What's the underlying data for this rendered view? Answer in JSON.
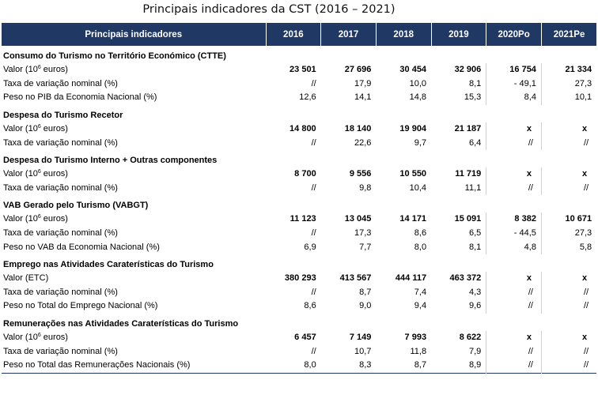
{
  "title": "Principais indicadores da CST (2016 – 2021)",
  "header": {
    "label": "Principais indicadores",
    "years": [
      "2016",
      "2017",
      "2018",
      "2019",
      "2020Po",
      "2021Pe"
    ]
  },
  "sections": [
    {
      "heading": "Consumo do Turismo no Território Económico (CTTE)",
      "rows": [
        {
          "label_pre": "Valor (10",
          "sup": "6",
          "label_post": " euros)",
          "type": "val",
          "values": [
            "23 501",
            "27 696",
            "30 454",
            "32 906",
            "16 754",
            "21 334"
          ]
        },
        {
          "label": "Taxa de variação nominal (%)",
          "values": [
            "//",
            "17,9",
            "10,0",
            "8,1",
            "-  49,1",
            "27,3"
          ]
        },
        {
          "label": "Peso no PIB da Economia Nacional (%)",
          "values": [
            "12,6",
            "14,1",
            "14,8",
            "15,3",
            "8,4",
            "10,1"
          ]
        }
      ]
    },
    {
      "heading": "Despesa do Turismo Recetor",
      "rows": [
        {
          "label_pre": "Valor (10",
          "sup": "6",
          "label_post": " euros)",
          "type": "val",
          "values": [
            "14 800",
            "18 140",
            "19 904",
            "21 187",
            "x",
            "x"
          ]
        },
        {
          "label": "Taxa de variação nominal (%)",
          "values": [
            "//",
            "22,6",
            "9,7",
            "6,4",
            "//",
            "//"
          ]
        }
      ]
    },
    {
      "heading": "Despesa do Turismo Interno + Outras componentes",
      "rows": [
        {
          "label_pre": "Valor (10",
          "sup": "6",
          "label_post": " euros)",
          "type": "val",
          "values": [
            "8 700",
            "9 556",
            "10 550",
            "11 719",
            "x",
            "x"
          ]
        },
        {
          "label": "Taxa de variação nominal (%)",
          "values": [
            "//",
            "9,8",
            "10,4",
            "11,1",
            "//",
            "//"
          ]
        }
      ]
    },
    {
      "heading": "VAB Gerado pelo Turismo (VABGT)",
      "rows": [
        {
          "label_pre": "Valor (10",
          "sup": "6",
          "label_post": " euros)",
          "type": "val",
          "values": [
            "11 123",
            "13 045",
            "14 171",
            "15 091",
            "8 382",
            "10 671"
          ]
        },
        {
          "label": "Taxa de variação nominal (%)",
          "values": [
            "//",
            "17,3",
            "8,6",
            "6,5",
            "-  44,5",
            "27,3"
          ]
        },
        {
          "label": "Peso no VAB da Economia Nacional (%)",
          "values": [
            "6,9",
            "7,7",
            "8,0",
            "8,1",
            "4,8",
            "5,8"
          ]
        }
      ]
    },
    {
      "heading": "Emprego nas Atividades Caraterísticas do Turismo",
      "rows": [
        {
          "label": "Valor (ETC)",
          "type": "val",
          "values": [
            "380 293",
            "413 567",
            "444 117",
            "463 372",
            "x",
            "x"
          ]
        },
        {
          "label": "Taxa de variação nominal (%)",
          "values": [
            "//",
            "8,7",
            "7,4",
            "4,3",
            "//",
            "//"
          ]
        },
        {
          "label": "Peso no Total do Emprego Nacional (%)",
          "values": [
            "8,6",
            "9,0",
            "9,4",
            "9,6",
            "//",
            "//"
          ]
        }
      ]
    },
    {
      "heading": "Remunerações nas Atividades Caraterísticas do Turismo",
      "rows": [
        {
          "label_pre": "Valor (10",
          "sup": "6",
          "label_post": " euros)",
          "type": "val",
          "values": [
            "6 457",
            "7 149",
            "7 993",
            "8 622",
            "x",
            "x"
          ]
        },
        {
          "label": "Taxa de variação nominal (%)",
          "values": [
            "//",
            "10,7",
            "11,8",
            "7,9",
            "//",
            "//"
          ]
        },
        {
          "label": "Peso  no Total das Remunerações Nacionais (%)",
          "values": [
            "8,0",
            "8,3",
            "8,7",
            "8,9",
            "//",
            "//"
          ]
        }
      ]
    }
  ]
}
